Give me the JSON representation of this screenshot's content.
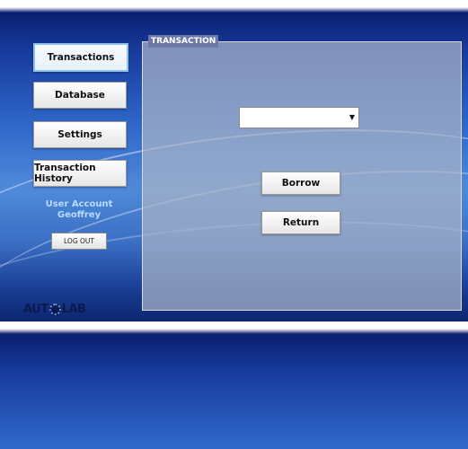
{
  "sidebar": {
    "items": [
      {
        "label": "Transactions",
        "active": true
      },
      {
        "label": "Database",
        "active": false
      },
      {
        "label": "Settings",
        "active": false
      },
      {
        "label": "Transaction History",
        "active": false
      }
    ],
    "user_account_label": "User Account",
    "user_name": "Geoffrey",
    "logout_label": "LOG OUT"
  },
  "panel": {
    "title": "TRANSACTION",
    "dropdown": {
      "selected": "",
      "icon": "dropdown-arrow-icon"
    },
    "borrow_label": "Borrow",
    "return_label": "Return"
  },
  "logo": {
    "text_left": "AUT",
    "text_right": "LAB"
  }
}
